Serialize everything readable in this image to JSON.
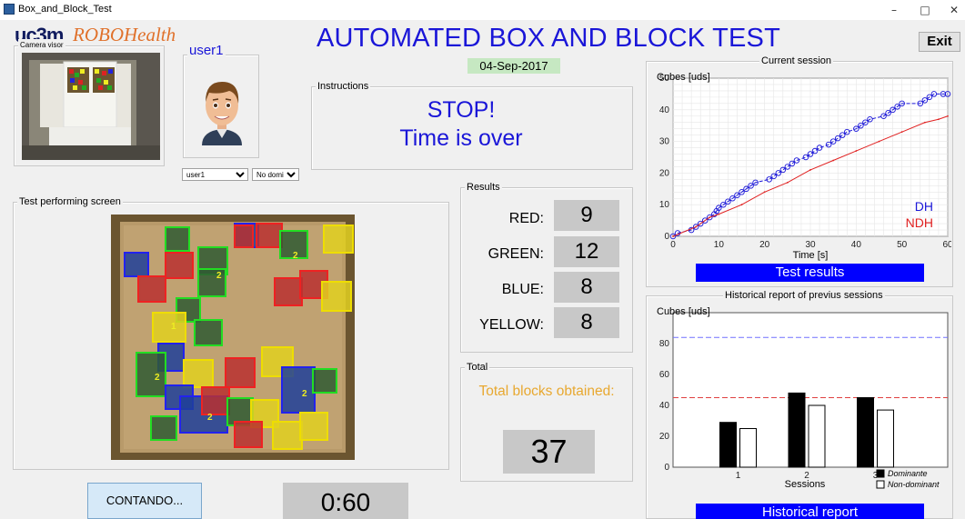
{
  "window": {
    "title": "Box_and_Block_Test",
    "minimize": "–",
    "maximize": "□",
    "close": "✕"
  },
  "logos": {
    "uc3m": "uc3m",
    "robohealth": "ROBOHealth"
  },
  "header": {
    "title": "AUTOMATED BOX AND BLOCK TEST",
    "date": "04-Sep-2017",
    "exit_label": "Exit"
  },
  "camera": {
    "legend": "Camera visor"
  },
  "user": {
    "legend": "user1",
    "user_select": "user1",
    "hand_select": "No domi..."
  },
  "instructions": {
    "legend": "Instructions",
    "line1": "STOP!",
    "line2": "Time is over"
  },
  "test_screen": {
    "legend": "Test performing screen",
    "detected_labels": [
      "2",
      "2",
      "1",
      "2",
      "2",
      "2"
    ]
  },
  "results": {
    "legend": "Results",
    "items": [
      {
        "label": "RED:",
        "value": "9"
      },
      {
        "label": "GREEN:",
        "value": "12"
      },
      {
        "label": "BLUE:",
        "value": "8"
      },
      {
        "label": "YELLOW:",
        "value": "8"
      }
    ]
  },
  "total": {
    "legend": "Total",
    "label": "Total blocks obtained:",
    "value": "37"
  },
  "controls": {
    "contando_label": "CONTANDO...",
    "timer": "0:60"
  },
  "current_session": {
    "legend": "Current session",
    "button": "Test results"
  },
  "historical": {
    "legend": "Historical report of previus sessions",
    "button": "Historical report"
  },
  "colors": {
    "accent_blue": "#1a16d8",
    "bar_blue": "#0000ff",
    "total_orange": "#e8a830",
    "date_green": "#c6e8c2"
  },
  "chart_data": [
    {
      "type": "line",
      "title": "",
      "ylabel": "Cubes [uds]",
      "xlabel": "Time [s]",
      "xlim": [
        0,
        60
      ],
      "ylim": [
        0,
        50
      ],
      "xticks": [
        0,
        10,
        20,
        30,
        40,
        50,
        60
      ],
      "yticks": [
        0,
        10,
        20,
        30,
        40,
        50
      ],
      "grid": true,
      "legend_position": "bottom-right",
      "series": [
        {
          "name": "DH",
          "color": "#1a16d8",
          "style": "dashed-circles",
          "x": [
            0,
            1,
            4,
            5,
            6,
            7,
            8,
            9,
            9.5,
            10,
            11,
            12,
            13,
            14,
            15,
            16,
            17,
            18,
            21,
            22,
            23,
            24,
            25,
            26,
            27,
            29,
            30,
            31,
            32,
            34,
            35,
            36,
            37,
            38,
            40,
            41,
            42,
            43,
            46,
            47,
            48,
            49,
            50,
            54,
            55,
            56,
            57,
            59,
            60
          ],
          "y": [
            0,
            1,
            2,
            3,
            4,
            5,
            6,
            7,
            8,
            9,
            10,
            11,
            12,
            13,
            14,
            15,
            16,
            17,
            18,
            19,
            20,
            21,
            22,
            23,
            24,
            25,
            26,
            27,
            28,
            29,
            30,
            31,
            32,
            33,
            34,
            35,
            36,
            37,
            38,
            39,
            40,
            41,
            42,
            42,
            43,
            44,
            45,
            45,
            45
          ]
        },
        {
          "name": "NDH",
          "color": "#e02020",
          "style": "solid",
          "x": [
            0,
            5,
            8,
            10,
            15,
            20,
            25,
            30,
            35,
            40,
            45,
            50,
            55,
            58,
            60
          ],
          "y": [
            0,
            3,
            6,
            7,
            10,
            14,
            17,
            21,
            24,
            27,
            30,
            33,
            36,
            37,
            38
          ]
        }
      ]
    },
    {
      "type": "bar",
      "title": "",
      "ylabel": "Cubes [uds]",
      "xlabel": "Sessions",
      "categories": [
        "1",
        "2",
        "3"
      ],
      "ylim": [
        0,
        100
      ],
      "yticks": [
        0,
        20,
        40,
        60,
        80
      ],
      "series": [
        {
          "name": "Dominante",
          "color": "#000000",
          "values": [
            29,
            48,
            45
          ]
        },
        {
          "name": "Non-dominant",
          "color": "#ffffff",
          "values": [
            25,
            40,
            37
          ]
        }
      ],
      "reference_lines": [
        {
          "color": "#7070ff",
          "value": 84
        },
        {
          "color": "#e04040",
          "value": 45
        }
      ]
    }
  ]
}
